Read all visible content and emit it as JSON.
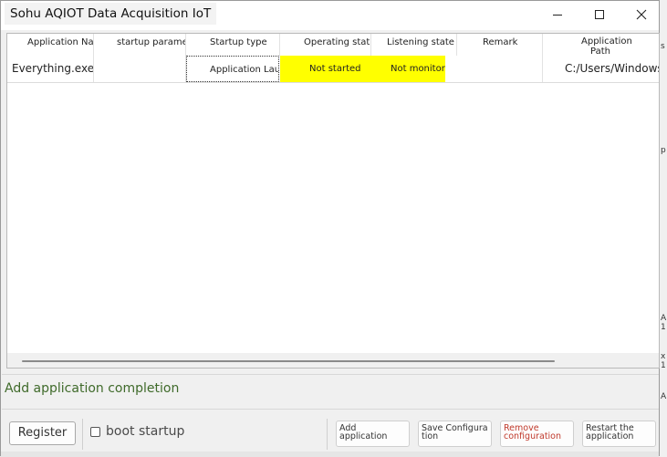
{
  "window": {
    "title": "Sohu AQIOT Data Acquisition IoT"
  },
  "titlebar_icons": {
    "minimize": "minimize-icon",
    "maximize": "maximize-icon",
    "close": "close-icon"
  },
  "table": {
    "columns": [
      {
        "label": "Application Name"
      },
      {
        "label": "startup parameters"
      },
      {
        "label": "Startup type"
      },
      {
        "label": "Operating status"
      },
      {
        "label": "Listening state"
      },
      {
        "label": "Remark"
      },
      {
        "label": "Application Path"
      }
    ],
    "rows": [
      {
        "name": "Everything.exe",
        "params": "",
        "startup_type": "Application Launch",
        "operating_status": "Not started",
        "listening_state": "Not monitored",
        "remark": "",
        "path": "C:/Users/Windows"
      }
    ],
    "status_highlight_color": "#ffff00"
  },
  "status_message": "Add application completion",
  "buttons": {
    "register": "Register",
    "boot_startup": "boot startup",
    "add_application": "Add application",
    "save_configuration": "Save Configuration",
    "remove_configuration": "Remove configuration",
    "restart_application": "Restart the application"
  },
  "background_fragments": [
    "s",
    "p",
    "A",
    "1",
    "x",
    "1",
    "A"
  ]
}
